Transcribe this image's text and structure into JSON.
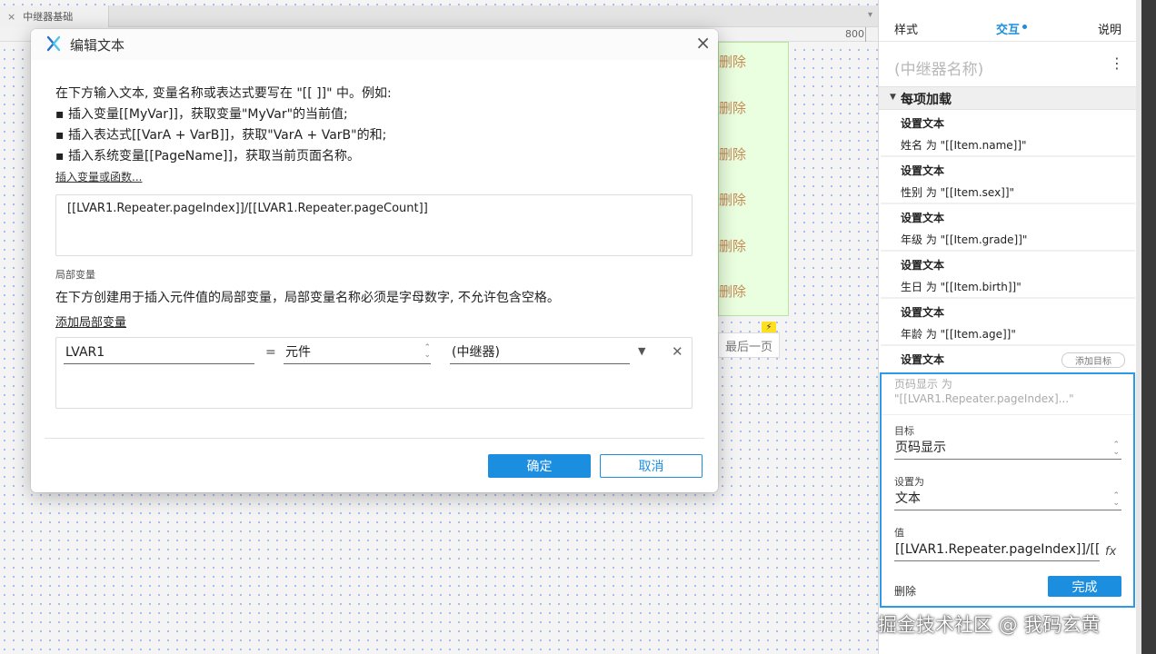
{
  "tabs": [
    {
      "label": "中继器基础",
      "close": "×"
    }
  ],
  "tabbar_left_close": "×",
  "ruler": {
    "mark": "800"
  },
  "repeater": {
    "delete_labels": [
      "删除",
      "删除",
      "删除",
      "删除",
      "删除",
      "删除"
    ],
    "last_page_label": "最后一页"
  },
  "dialog": {
    "title": "编辑文本",
    "intro_lines": [
      "在下方输入文本, 变量名称或表达式要写在 \"[[ ]]\" 中。例如:",
      "▪ 插入变量[[MyVar]]，获取变量\"MyVar\"的当前值;",
      "▪ 插入表达式[[VarA + VarB]]，获取\"VarA + VarB\"的和;",
      "▪ 插入系统变量[[PageName]]，获取当前页面名称。"
    ],
    "insert_link": "插入变量或函数...",
    "text_value": "[[LVAR1.Repeater.pageIndex]]/[[LVAR1.Repeater.pageCount]]",
    "local_var_heading": "局部变量",
    "local_var_desc": "在下方创建用于插入元件值的局部变量，局部变量名称必须是字母数字, 不允许包含空格。",
    "add_local_link": "添加局部变量",
    "local_var": {
      "name": "LVAR1",
      "equals": "=",
      "type": "元件",
      "target": "(中继器)"
    },
    "ok_label": "确定",
    "cancel_label": "取消",
    "close": "×"
  },
  "panel": {
    "tabs": {
      "style": "样式",
      "interact": "交互",
      "notes": "说明"
    },
    "widget_name": "(中继器名称)",
    "section_label": "每项加载",
    "actions": [
      {
        "title": "设置文本",
        "detail": "姓名 为 \"[[Item.name]]\""
      },
      {
        "title": "设置文本",
        "detail": "性别 为 \"[[Item.sex]]\""
      },
      {
        "title": "设置文本",
        "detail": "年级 为 \"[[Item.grade]]\""
      },
      {
        "title": "设置文本",
        "detail": "生日 为 \"[[Item.birth]]\""
      },
      {
        "title": "设置文本",
        "detail": "年龄 为 \"[[Item.age]]\""
      },
      {
        "title": "设置文本",
        "detail": ""
      }
    ],
    "add_target_label": "添加目标",
    "edit": {
      "summary_line1": "页码显示 为",
      "summary_line2": "\"[[LVAR1.Repeater.pageIndex]...\"",
      "target_label": "目标",
      "target_value": "页码显示",
      "set_as_label": "设置为",
      "set_as_value": "文本",
      "value_label": "值",
      "value_text": "[[LVAR1.Repeater.pageIndex]]/[[L",
      "fx_label": "fx",
      "delete_label": "删除",
      "done_label": "完成"
    }
  },
  "watermark": "掘金技术社区 @ 我码玄黄",
  "colors": {
    "accent": "#1c8ee0",
    "repeater_bg": "#eaffdf",
    "delete_text": "#c58a55"
  }
}
